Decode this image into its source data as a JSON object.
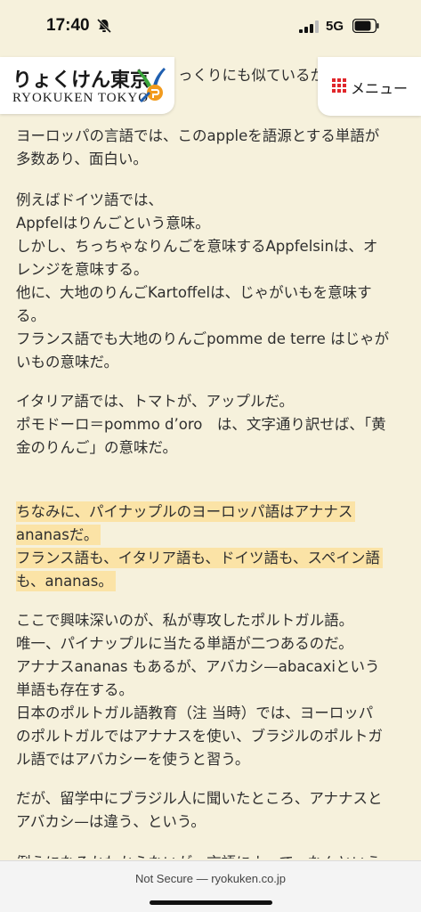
{
  "status": {
    "time": "17:40",
    "network": "5G",
    "icons": [
      "bell-slash-icon",
      "signal-icon",
      "battery-icon"
    ]
  },
  "header": {
    "logo_jp": "りょくけん東京",
    "logo_en": "RYOKUKEN TOKYO",
    "menu_label": "メニュー",
    "menu_icon": "grid-icon"
  },
  "content": {
    "cut_top": "っくりにも似ているか",
    "paragraphs": [
      [
        "ヨーロッパの言語では、このappleを語源とする単語が",
        "多数あり、面白い。"
      ],
      [
        "例えばドイツ語では、",
        "Appfelはりんごという意味。",
        "しかし、ちっちゃなりんごを意味するAppfelsinは、オ",
        "レンジを意味する。",
        "他に、大地のりんごKartoffelは、じゃがいもを意味す",
        "る。",
        "フランス語でも大地のりんごpomme de terre はじゃが",
        "いもの意味だ。"
      ],
      [
        "イタリア語では、トマトが、アップルだ。",
        "ポモドーロ＝pommo d’oro　は、文字通り訳せば、「黄",
        "金のりんご」の意味だ。"
      ],
      [
        "ちなみに、パイナップルのヨーロッパ語はアナナス",
        "ananasだ。",
        "フランス語も、イタリア語も、ドイツ語も、スペイン語",
        "も、ananas。"
      ],
      [
        "ここで興味深いのが、私が専攻したポルトガル語。",
        "唯一、パイナップルに当たる単語が二つあるのだ。",
        "アナナスananas もあるが、アバカシ—abacaxiという",
        "単語も存在する。",
        "日本のポルトガル語教育（注 当時）では、ヨーロッパ",
        "のポルトガルではアナナスを使い、ブラジルのポルトガ",
        "ル語ではアバカシーを使うと習う。"
      ],
      [
        "だが、留学中にブラジル人に聞いたところ、アナナスと",
        "アバカシ—は違う、という。"
      ]
    ],
    "cut_bottom": "例えになるかわからないが、言語によって、なんという"
  },
  "colors": {
    "background": "#f6f1dc",
    "highlight": "#fbe3a6",
    "logo_green": "#3aa63a",
    "logo_blue": "#1f5fb0",
    "logo_orange": "#f29b1e",
    "menu_icon_red": "#e0262b"
  },
  "browser": {
    "url_text": "Not Secure — ryokuken.co.jp"
  }
}
